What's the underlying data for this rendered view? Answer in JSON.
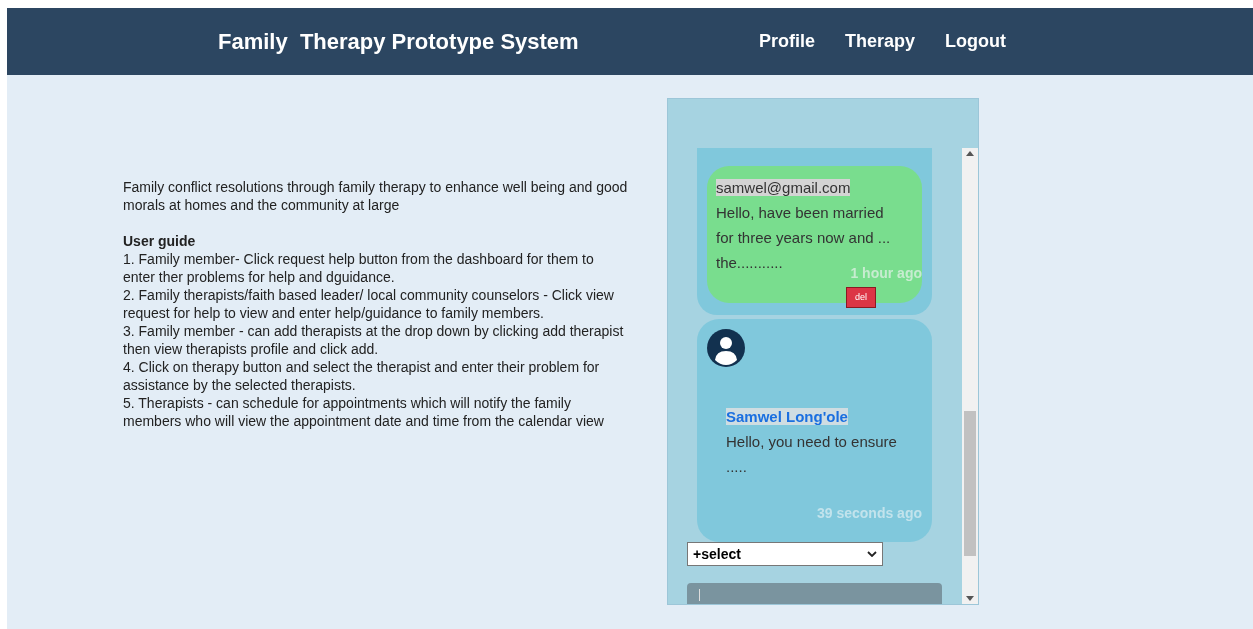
{
  "header": {
    "title": "Family  Therapy Prototype System",
    "nav": [
      "Profile",
      "Therapy",
      "Logout"
    ]
  },
  "intro": {
    "text": "Family conflict resolutions through family therapy to enhance well being and good morals at homes and the community at large",
    "guide_title": "User guide",
    "steps": [
      "1. Family member- Click request help button from the dashboard for them to enter ther problems for help and dguidance.",
      "2. Family therapists/faith based leader/ local community counselors - Click view request for help to view and enter help/guidance to family members.",
      "3. Family member - can add therapists at the drop down by clicking add therapist then view therapists profile and click add.",
      "4. Click on therapy button and select the therapist and enter their problem for assistance by the selected therapists.",
      "5. Therapists - can schedule for appointments which will notify the family members who will view the appointment date and time from the calendar view"
    ]
  },
  "chat": {
    "messages": [
      {
        "kind": "sent",
        "sender": "samwel@gmail.com",
        "lines": [
          "Hello, have been married",
          "for three years now and ...",
          "the..........."
        ],
        "time": "1 hour ago",
        "action": "del"
      },
      {
        "kind": "received",
        "sender": "Samwel Long'ole",
        "lines": [
          "Hello, you need to ensure",
          "....."
        ],
        "time": "39 seconds ago"
      }
    ],
    "select": {
      "value": "+select"
    }
  }
}
